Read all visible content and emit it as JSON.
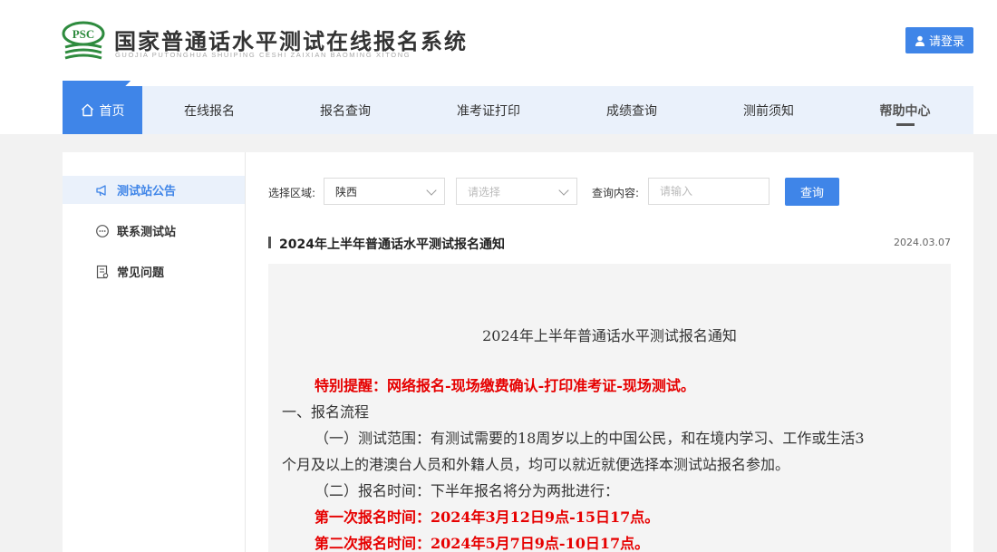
{
  "header": {
    "logo_text": "PSC",
    "title": "国家普通话水平测试在线报名系统",
    "subtitle": "GUOJIA PUTONGHUA SHUIPING CESHI ZAIXIAN BAOMING XITONG",
    "login_label": "请登录"
  },
  "nav": {
    "items": [
      {
        "label": "首页"
      },
      {
        "label": "在线报名"
      },
      {
        "label": "报名查询"
      },
      {
        "label": "准考证打印"
      },
      {
        "label": "成绩查询"
      },
      {
        "label": "测前须知"
      },
      {
        "label": "帮助中心"
      }
    ]
  },
  "sidebar": {
    "items": [
      {
        "label": "测试站公告",
        "icon": "megaphone-icon"
      },
      {
        "label": "联系测试站",
        "icon": "chat-icon"
      },
      {
        "label": "常见问题",
        "icon": "document-icon"
      }
    ]
  },
  "filter": {
    "region_label": "选择区域:",
    "region_value": "陕西",
    "second_placeholder": "请选择",
    "query_label": "查询内容:",
    "query_placeholder": "请输入",
    "query_button": "查询"
  },
  "article": {
    "title": "2024年上半年普通话水平测试报名通知",
    "date": "2024.03.07",
    "body_title": "2024年上半年普通话水平测试报名通知",
    "lines": [
      "特别提醒：网络报名-现场缴费确认-打印准考证-现场测试。",
      "一、报名流程",
      "（一）测试范围：有测试需要的18周岁以上的中国公民，和在境内学习、工作或生活3",
      "个月及以上的港澳台人员和外籍人员，均可以就近就便选择本测试站报名参加。",
      "（二）报名时间：下半年报名将分为两批进行：",
      "第一次报名时间：2024年3月12日9点-15日17点。",
      "第二次报名时间：2024年5月7日9点-10日17点。"
    ]
  },
  "colors": {
    "accent": "#3f85e8",
    "nav_bg": "#eaf1fb",
    "highlight_red": "#e60000"
  }
}
